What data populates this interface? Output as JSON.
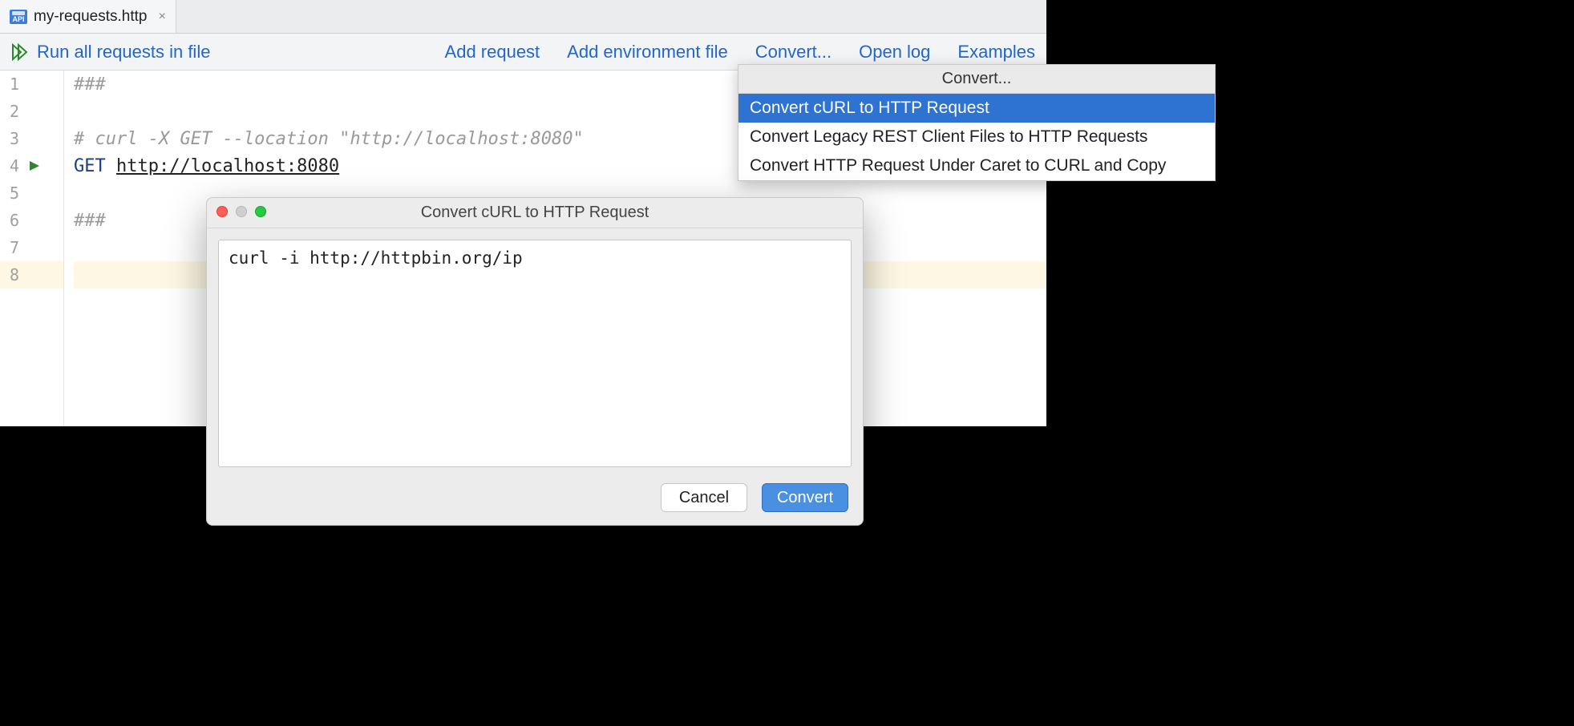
{
  "tab": {
    "icon_label": "API",
    "filename": "my-requests.http",
    "close_glyph": "×"
  },
  "toolbar": {
    "run_all": "Run all requests in file",
    "add_request": "Add request",
    "add_env_file": "Add environment file",
    "convert": "Convert...",
    "open_log": "Open log",
    "examples": "Examples"
  },
  "gutter": {
    "lines": [
      "1",
      "2",
      "3",
      "4",
      "5",
      "6",
      "7",
      "8"
    ]
  },
  "code": {
    "l1": "###",
    "l2": "",
    "l3": "# curl -X GET --location \"http://localhost:8080\"",
    "l4_method": "GET",
    "l4_url": "http://localhost:8080",
    "l5": "",
    "l6": "###",
    "l7": "",
    "l8": ""
  },
  "context_menu": {
    "header": "Convert...",
    "items": [
      {
        "label": "Convert cURL to HTTP Request",
        "selected": true
      },
      {
        "label": "Convert Legacy REST Client Files to HTTP Requests",
        "selected": false
      },
      {
        "label": "Convert HTTP Request Under Caret to CURL and Copy",
        "selected": false
      }
    ]
  },
  "dialog": {
    "title": "Convert cURL to HTTP Request",
    "text": "curl -i http://httpbin.org/ip",
    "cancel": "Cancel",
    "convert": "Convert"
  }
}
